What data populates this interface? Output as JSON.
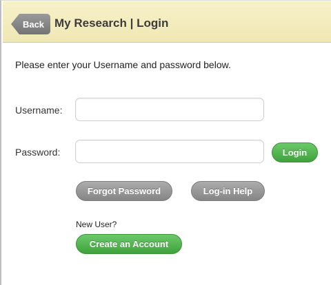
{
  "header": {
    "back_label": "Back",
    "title": "My Research | Login"
  },
  "form": {
    "instruction": "Please enter your Username and password below.",
    "username_label": "Username:",
    "username_value": "",
    "password_label": "Password:",
    "password_value": "",
    "login_label": "Login"
  },
  "actions": {
    "forgot_label": "Forgot Password",
    "help_label": "Log-in Help"
  },
  "signup": {
    "prompt": "New User?",
    "create_label": "Create an Account"
  },
  "colors": {
    "header_bg": "#f3ecc0",
    "green_button": "#4fb14c",
    "gray_button": "#959595"
  }
}
